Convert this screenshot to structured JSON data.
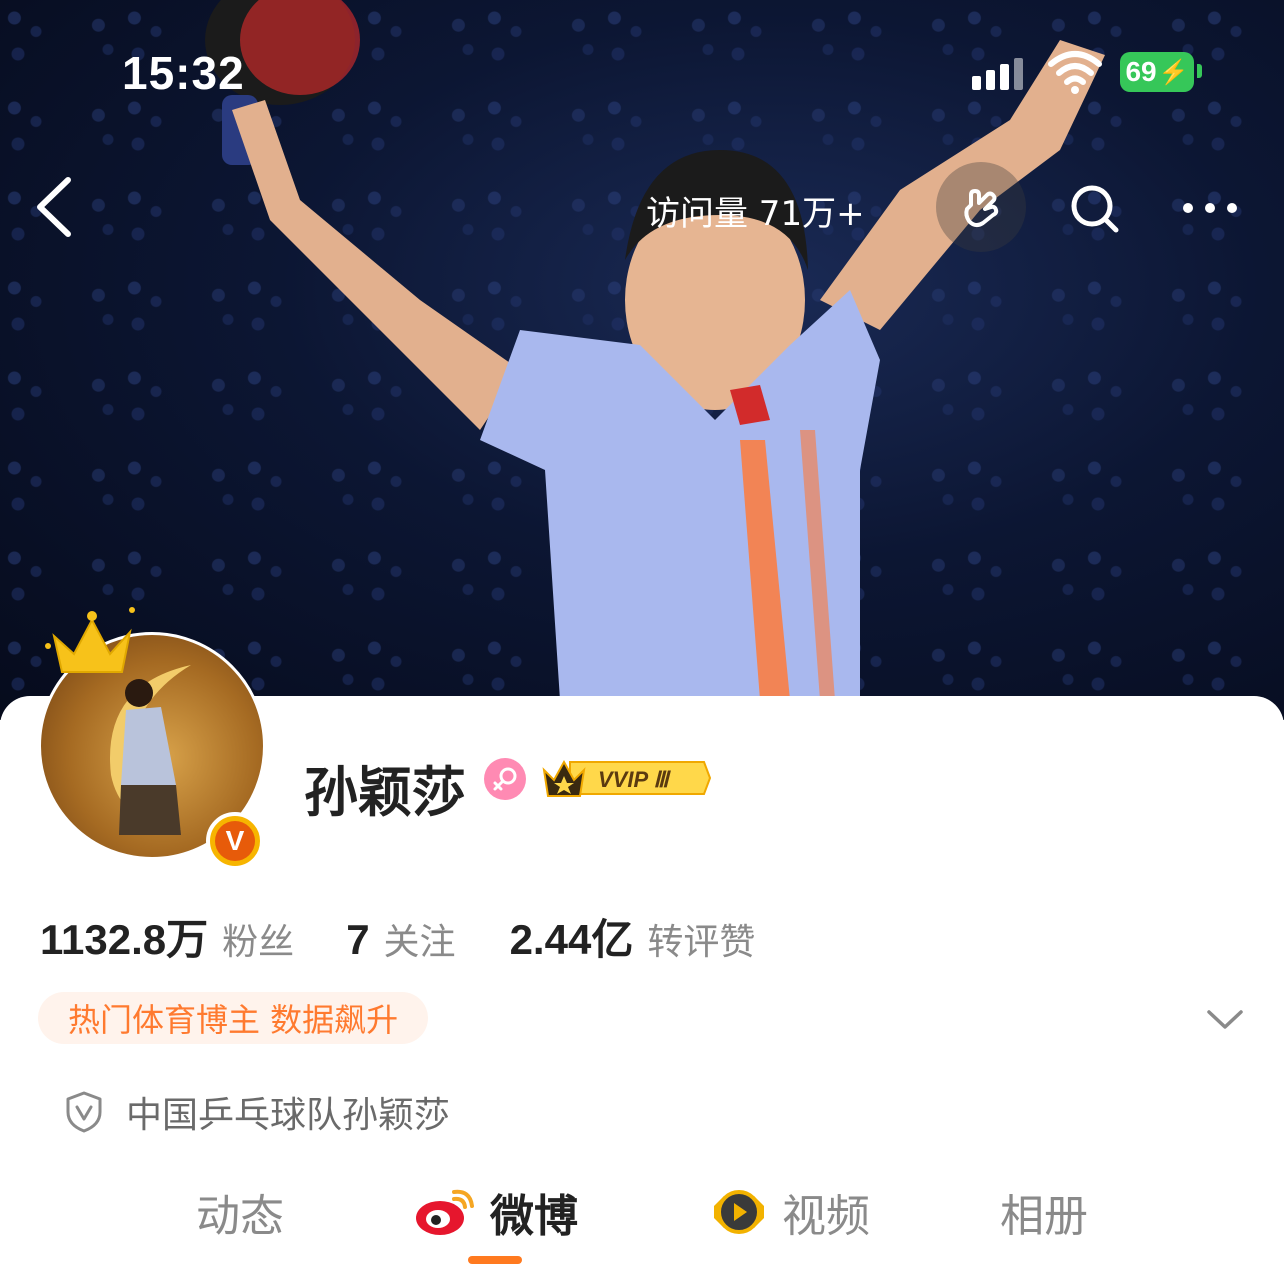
{
  "status_bar": {
    "time": "15:32",
    "battery": "69"
  },
  "header": {
    "visits_label": "访问量 71万+"
  },
  "profile": {
    "name": "孙颖莎",
    "vip_label": "VVIP Ⅲ",
    "verified_badge": "V",
    "stats": [
      {
        "value": "1132.8",
        "unit": "万",
        "label": "粉丝"
      },
      {
        "value": "7",
        "unit": "",
        "label": "关注"
      },
      {
        "value": "2.44",
        "unit": "亿",
        "label": "转评赞"
      }
    ],
    "tag": "热门体育博主 数据飙升",
    "verification": "中国乒乓球队孙颖莎"
  },
  "tabs": [
    {
      "label": "动态"
    },
    {
      "label": "微博"
    },
    {
      "label": "视频"
    },
    {
      "label": "相册"
    }
  ],
  "colors": {
    "accent": "#ff7a1f",
    "tag_bg": "#fff3ec",
    "battery": "#36c759"
  }
}
